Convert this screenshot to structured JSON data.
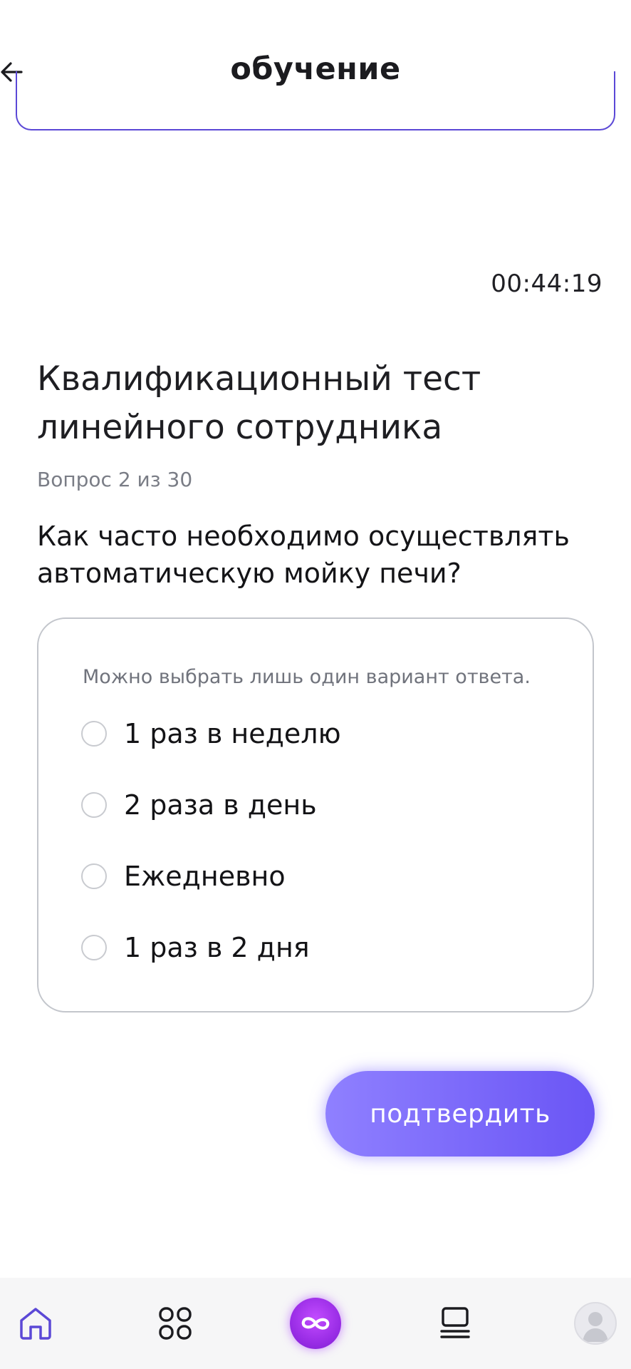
{
  "header": {
    "title": "обучение"
  },
  "timer": "00:44:19",
  "test": {
    "title": "Квалификационный тест линейного сотрудника",
    "counter": "Вопрос 2 из 30",
    "question": "Как часто необходимо осуществлять автоматическую мойку печи?"
  },
  "answers": {
    "hint": "Можно выбрать лишь один вариант ответа.",
    "options": [
      {
        "label": "1 раз в неделю"
      },
      {
        "label": "2 раза в день"
      },
      {
        "label": "Ежедневно"
      },
      {
        "label": "1 раз в 2 дня"
      }
    ]
  },
  "confirm": {
    "label": "подтвердить"
  },
  "nav": {
    "items": [
      {
        "icon": "home-icon",
        "active": true
      },
      {
        "icon": "grid-icon",
        "active": false
      },
      {
        "icon": "infinity-icon",
        "active": false
      },
      {
        "icon": "list-icon",
        "active": false
      },
      {
        "icon": "avatar-icon",
        "active": false
      }
    ]
  },
  "colors": {
    "accent": "#6a55f5",
    "accent_light": "#8f80ff",
    "active_nav": "#5b48d6",
    "center_nav": "#9a2de6",
    "card_border": "#c3c6cc"
  }
}
